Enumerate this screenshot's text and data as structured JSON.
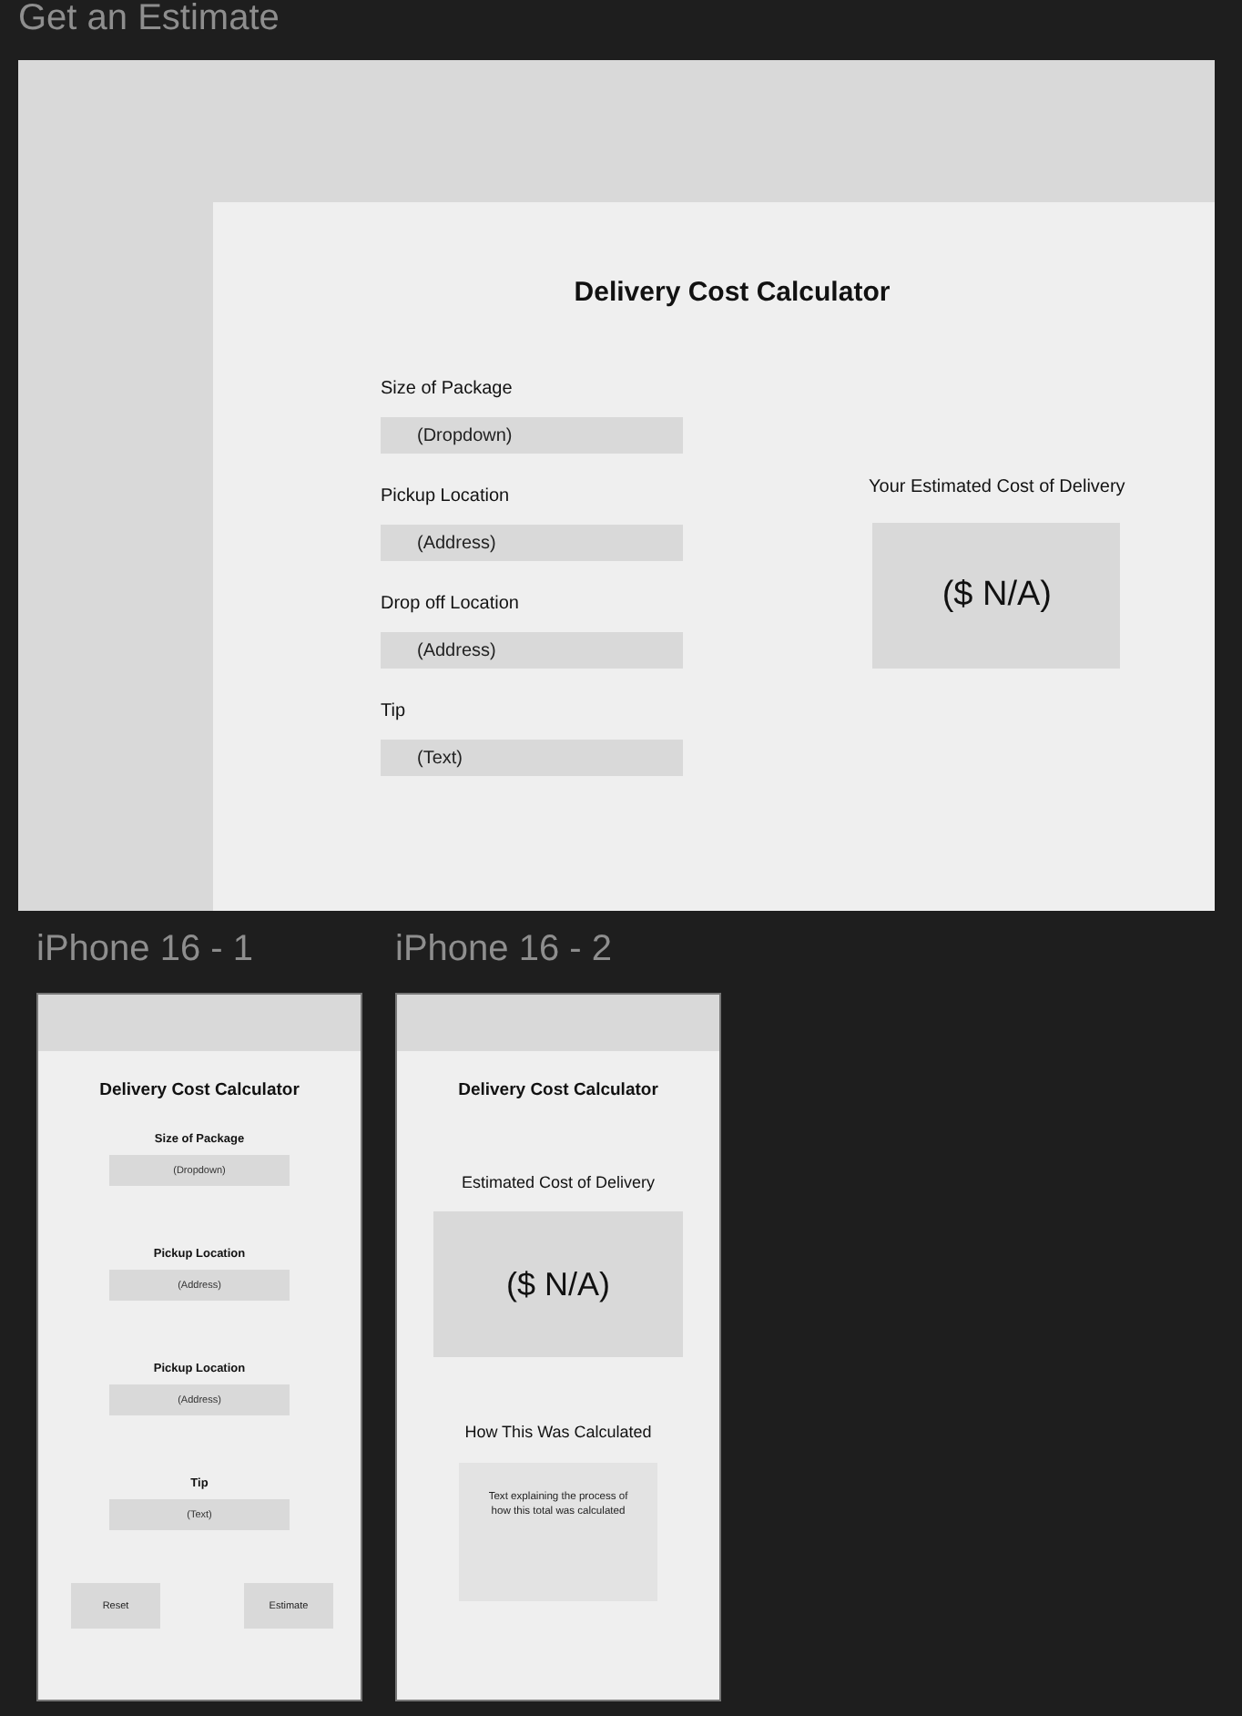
{
  "canvas_title": "Get an Estimate",
  "desktop": {
    "title": "Delivery Cost Calculator",
    "fields": [
      {
        "label": "Size of Package",
        "placeholder": "(Dropdown)"
      },
      {
        "label": "Pickup Location",
        "placeholder": "(Address)"
      },
      {
        "label": "Drop off Location",
        "placeholder": "(Address)"
      },
      {
        "label": "Tip",
        "placeholder": "(Text)"
      }
    ],
    "result": {
      "label": "Your Estimated Cost of Delivery",
      "value": "($ N/A)"
    }
  },
  "phones": [
    {
      "name": "iPhone 16 - 1",
      "kind": "form",
      "title": "Delivery Cost Calculator",
      "fields": [
        {
          "label": "Size of Package",
          "placeholder": "(Dropdown)"
        },
        {
          "label": "Pickup Location",
          "placeholder": "(Address)"
        },
        {
          "label": "Pickup Location",
          "placeholder": "(Address)"
        },
        {
          "label": "Tip",
          "placeholder": "(Text)"
        }
      ],
      "buttons": [
        "Reset",
        "Estimate"
      ]
    },
    {
      "name": "iPhone 16 - 2",
      "kind": "result",
      "title": "Delivery Cost Calculator",
      "result_label": "Estimated Cost of Delivery",
      "value": "($ N/A)",
      "explain_title": "How This Was Calculated",
      "explain_text": "Text explaining the process of how this total was calculated"
    }
  ]
}
